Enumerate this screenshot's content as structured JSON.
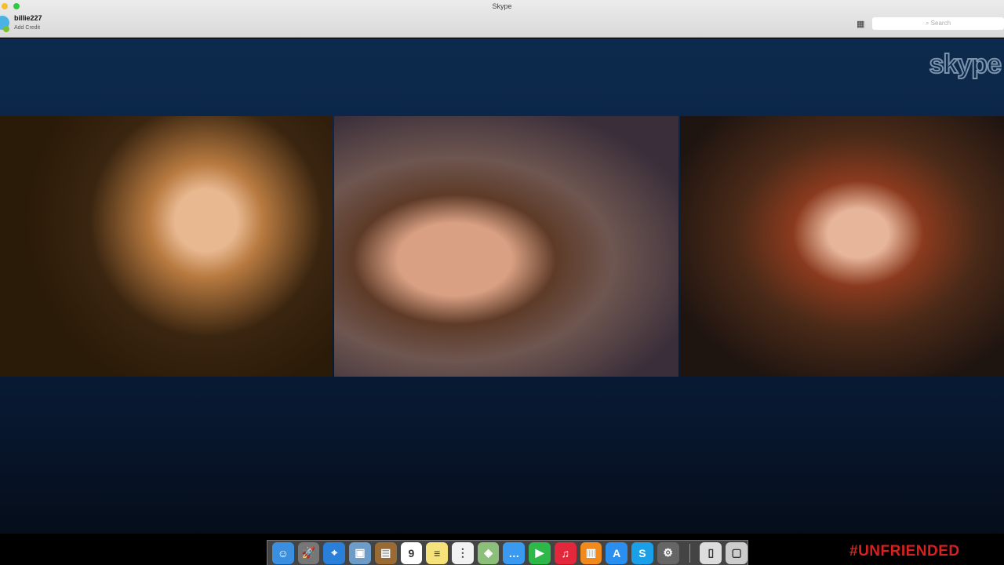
{
  "window": {
    "title": "Skype"
  },
  "account": {
    "username": "billie227",
    "credit_label": "Add Credit"
  },
  "search": {
    "placeholder": "Search"
  },
  "logo": "skype",
  "call": {
    "participants": [
      "participant-1",
      "participant-2",
      "participant-3"
    ]
  },
  "dock": {
    "apps": [
      {
        "name": "finder",
        "glyph": "☺",
        "color": "#3b8fe0"
      },
      {
        "name": "launchpad",
        "glyph": "🚀",
        "color": "#777"
      },
      {
        "name": "safari",
        "glyph": "⌖",
        "color": "#2a7fd8"
      },
      {
        "name": "preview",
        "glyph": "▣",
        "color": "#6e9cc8"
      },
      {
        "name": "contacts",
        "glyph": "▤",
        "color": "#9a6a35"
      },
      {
        "name": "calendar",
        "glyph": "9",
        "color": "#ffffff"
      },
      {
        "name": "notes",
        "glyph": "≡",
        "color": "#f5e27a"
      },
      {
        "name": "reminders",
        "glyph": "⋮",
        "color": "#f2f2f2"
      },
      {
        "name": "maps",
        "glyph": "◈",
        "color": "#8bbf7a"
      },
      {
        "name": "messages",
        "glyph": "…",
        "color": "#3a9af0"
      },
      {
        "name": "facetime",
        "glyph": "▶",
        "color": "#2eb84a"
      },
      {
        "name": "itunes",
        "glyph": "♫",
        "color": "#e2283a"
      },
      {
        "name": "ibooks",
        "glyph": "▥",
        "color": "#f08a1c"
      },
      {
        "name": "app-store",
        "glyph": "A",
        "color": "#2b8ff0"
      },
      {
        "name": "skype",
        "glyph": "S",
        "color": "#1aa0e8"
      },
      {
        "name": "system-preferences",
        "glyph": "⚙",
        "color": "#666"
      }
    ],
    "trailing": [
      {
        "name": "documents",
        "glyph": "▯",
        "color": "#ddd"
      },
      {
        "name": "trash",
        "glyph": "▢",
        "color": "#ccc"
      }
    ]
  },
  "watermark": "#UNFRIENDED"
}
